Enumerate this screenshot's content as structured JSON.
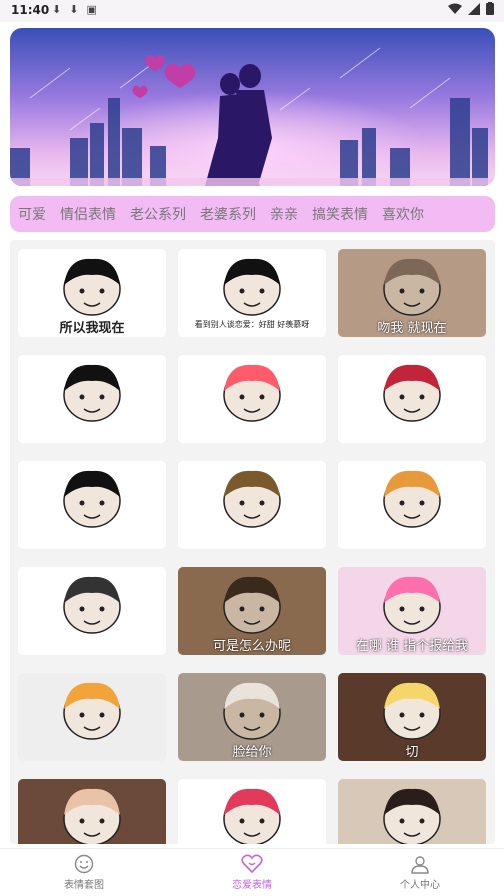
{
  "status_bar": {
    "time": "11:40"
  },
  "categories": [
    "可爱",
    "情侣表情",
    "老公系列",
    "老婆系列",
    "亲亲",
    "搞笑表情",
    "喜欢你"
  ],
  "stickers": [
    {
      "caption": "所以我现在",
      "style": "dark",
      "theme": "panda-man"
    },
    {
      "caption": "看到别人谈恋爱：好甜 好羡慕呀",
      "style": "small",
      "theme": "panda-man"
    },
    {
      "caption": "吻我 就现在",
      "style": "light",
      "theme": "cats-kiss"
    },
    {
      "caption": "",
      "style": "dark",
      "theme": "panda-man"
    },
    {
      "caption": "",
      "style": "dark",
      "theme": "cartoon-girl"
    },
    {
      "caption": "",
      "style": "small",
      "theme": "panda-flowers"
    },
    {
      "caption": "",
      "style": "dark",
      "theme": "panda-blush"
    },
    {
      "caption": "",
      "style": "dark",
      "theme": "climber"
    },
    {
      "caption": "",
      "style": "dark",
      "theme": "dog-heart"
    },
    {
      "caption": "",
      "style": "dark",
      "theme": "doodle-face"
    },
    {
      "caption": "可是怎么办呢",
      "style": "light",
      "theme": "cat-eye"
    },
    {
      "caption": "在哪 谁 指个报给我",
      "style": "light",
      "theme": "melody"
    },
    {
      "caption": "",
      "style": "small",
      "theme": "collage"
    },
    {
      "caption": "脸给你",
      "style": "light",
      "theme": "cat-face"
    },
    {
      "caption": "切",
      "style": "light",
      "theme": "alice"
    },
    {
      "caption": "",
      "style": "dark",
      "theme": "laugh-man"
    },
    {
      "caption": "",
      "style": "dark",
      "theme": "panda-hearts"
    },
    {
      "caption": "",
      "style": "dark",
      "theme": "bear"
    }
  ],
  "tabs": [
    {
      "label": "表情套图",
      "icon": "smile-icon",
      "active": false
    },
    {
      "label": "恋爱表情",
      "icon": "heart-icon",
      "active": true
    },
    {
      "label": "个人中心",
      "icon": "user-icon",
      "active": false
    }
  ],
  "colors": {
    "accent": "#c75ee8",
    "category_bg": "#f2bbf3"
  }
}
